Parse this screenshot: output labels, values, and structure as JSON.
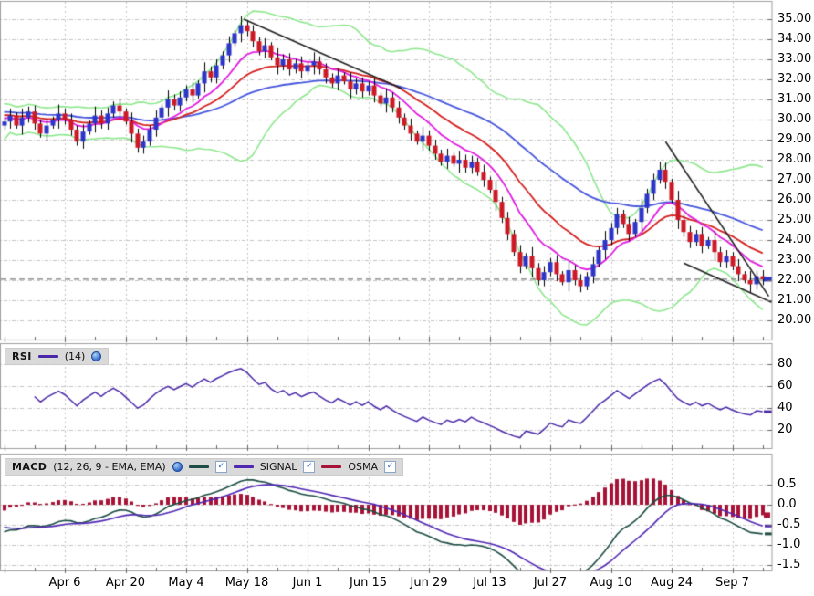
{
  "chart_data": {
    "type": "candlestick",
    "panels": [
      "price",
      "rsi",
      "macd"
    ],
    "price_axis_labels": [
      {
        "v": 35,
        "t": "35.00"
      },
      {
        "v": 34,
        "t": "34.00"
      },
      {
        "v": 33,
        "t": "33.00"
      },
      {
        "v": 32,
        "t": "32.00"
      },
      {
        "v": 31,
        "t": "31.00"
      },
      {
        "v": 30,
        "t": "30.00"
      },
      {
        "v": 29,
        "t": "29.00"
      },
      {
        "v": 28,
        "t": "28.00"
      },
      {
        "v": 27,
        "t": "27.00"
      },
      {
        "v": 26,
        "t": "26.00"
      },
      {
        "v": 25,
        "t": "25.00"
      },
      {
        "v": 24,
        "t": "24.00"
      },
      {
        "v": 23,
        "t": "23.00"
      },
      {
        "v": 22,
        "t": "22.00"
      },
      {
        "v": 21,
        "t": "21.00"
      },
      {
        "v": 20,
        "t": "20.00"
      }
    ],
    "x_ticks": [
      {
        "day": 10,
        "label": "Apr 6"
      },
      {
        "day": 20,
        "label": "Apr 20"
      },
      {
        "day": 30,
        "label": "May 4"
      },
      {
        "day": 40,
        "label": "May 18"
      },
      {
        "day": 50,
        "label": "Jun 1"
      },
      {
        "day": 60,
        "label": "Jun 15"
      },
      {
        "day": 70,
        "label": "Jun 29"
      },
      {
        "day": 80,
        "label": "Jul 13"
      },
      {
        "day": 90,
        "label": "Jul 27"
      },
      {
        "day": 100,
        "label": "Aug 10"
      },
      {
        "day": 110,
        "label": "Aug 24"
      },
      {
        "day": 120,
        "label": "Sep 7"
      }
    ],
    "candles": [
      [
        29.7,
        30.1,
        29.5,
        29.9
      ],
      [
        29.9,
        30.55,
        29.55,
        30.2
      ],
      [
        30.2,
        30.35,
        29.55,
        29.7
      ],
      [
        29.7,
        30.55,
        29.25,
        30.1
      ],
      [
        30.1,
        30.65,
        29.85,
        30.4
      ],
      [
        30.4,
        30.7,
        29.5,
        29.8
      ],
      [
        29.8,
        30.0,
        29.1,
        29.3
      ],
      [
        29.3,
        30.05,
        28.95,
        29.7
      ],
      [
        29.7,
        30.15,
        29.55,
        30.0
      ],
      [
        30.0,
        30.75,
        29.55,
        30.3
      ],
      [
        30.3,
        30.55,
        29.75,
        30.0
      ],
      [
        30.0,
        30.3,
        29.2,
        29.5
      ],
      [
        29.5,
        29.7,
        28.7,
        28.9
      ],
      [
        28.9,
        29.75,
        28.55,
        29.4
      ],
      [
        29.4,
        29.95,
        29.25,
        29.8
      ],
      [
        29.8,
        30.65,
        29.35,
        30.2
      ],
      [
        30.2,
        30.45,
        29.55,
        29.8
      ],
      [
        29.8,
        30.6,
        29.5,
        30.3
      ],
      [
        30.3,
        30.9,
        30.1,
        30.7
      ],
      [
        30.7,
        31.05,
        30.05,
        30.4
      ],
      [
        30.4,
        30.55,
        29.75,
        29.9
      ],
      [
        29.9,
        30.35,
        28.85,
        29.3
      ],
      [
        29.3,
        29.55,
        28.35,
        28.6
      ],
      [
        28.6,
        29.2,
        28.3,
        28.9
      ],
      [
        28.9,
        29.7,
        28.7,
        29.5
      ],
      [
        29.5,
        30.45,
        29.15,
        30.1
      ],
      [
        30.1,
        30.75,
        29.95,
        30.6
      ],
      [
        30.6,
        31.45,
        30.15,
        31.0
      ],
      [
        31.0,
        31.25,
        30.45,
        30.7
      ],
      [
        30.7,
        31.4,
        30.4,
        31.1
      ],
      [
        31.1,
        31.7,
        30.9,
        31.5
      ],
      [
        31.5,
        31.85,
        30.85,
        31.2
      ],
      [
        31.2,
        31.95,
        31.05,
        31.8
      ],
      [
        31.8,
        32.85,
        31.35,
        32.4
      ],
      [
        32.4,
        32.65,
        31.85,
        32.1
      ],
      [
        32.1,
        33.0,
        31.8,
        32.7
      ],
      [
        32.7,
        33.4,
        32.5,
        33.2
      ],
      [
        33.2,
        34.15,
        32.85,
        33.8
      ],
      [
        33.8,
        34.45,
        33.65,
        34.3
      ],
      [
        34.3,
        35.15,
        33.85,
        34.7
      ],
      [
        34.7,
        34.95,
        34.15,
        34.4
      ],
      [
        34.4,
        34.7,
        33.6,
        33.9
      ],
      [
        33.9,
        34.1,
        33.2,
        33.4
      ],
      [
        33.4,
        34.05,
        33.05,
        33.7
      ],
      [
        33.7,
        33.85,
        32.95,
        33.1
      ],
      [
        33.1,
        33.55,
        32.25,
        32.7
      ],
      [
        32.7,
        33.25,
        32.45,
        33.0
      ],
      [
        33.0,
        33.3,
        32.2,
        32.5
      ],
      [
        32.5,
        33.0,
        32.3,
        32.8
      ],
      [
        32.8,
        33.15,
        32.05,
        32.4
      ],
      [
        32.4,
        32.85,
        32.25,
        32.7
      ],
      [
        32.7,
        33.35,
        32.25,
        32.9
      ],
      [
        32.9,
        33.15,
        32.25,
        32.5
      ],
      [
        32.5,
        32.8,
        31.8,
        32.1
      ],
      [
        32.1,
        32.3,
        31.6,
        31.8
      ],
      [
        31.8,
        32.55,
        31.45,
        32.2
      ],
      [
        32.2,
        32.35,
        31.75,
        31.9
      ],
      [
        31.9,
        32.35,
        31.05,
        31.5
      ],
      [
        31.5,
        32.05,
        31.25,
        31.8
      ],
      [
        31.8,
        32.1,
        31.1,
        31.4
      ],
      [
        31.4,
        31.9,
        31.2,
        31.7
      ],
      [
        31.7,
        32.05,
        30.85,
        31.2
      ],
      [
        31.2,
        31.35,
        30.65,
        30.8
      ],
      [
        30.8,
        31.55,
        30.35,
        31.1
      ],
      [
        31.1,
        31.35,
        30.35,
        30.6
      ],
      [
        30.6,
        30.9,
        29.8,
        30.1
      ],
      [
        30.1,
        30.3,
        29.5,
        29.7
      ],
      [
        29.7,
        30.05,
        28.95,
        29.3
      ],
      [
        29.3,
        29.45,
        28.75,
        28.9
      ],
      [
        28.9,
        29.65,
        28.45,
        29.2
      ],
      [
        29.2,
        29.45,
        28.45,
        28.7
      ],
      [
        28.7,
        29.0,
        28.0,
        28.3
      ],
      [
        28.3,
        28.5,
        27.7,
        27.9
      ],
      [
        27.9,
        28.55,
        27.55,
        28.2
      ],
      [
        28.2,
        28.35,
        27.65,
        27.8
      ],
      [
        27.8,
        28.45,
        27.35,
        28.0
      ],
      [
        28.0,
        28.25,
        27.35,
        27.6
      ],
      [
        27.6,
        28.2,
        27.3,
        27.9
      ],
      [
        27.9,
        28.1,
        27.2,
        27.4
      ],
      [
        27.4,
        27.75,
        26.65,
        27.0
      ],
      [
        27.0,
        27.15,
        26.35,
        26.5
      ],
      [
        26.5,
        26.95,
        25.45,
        25.9
      ],
      [
        25.9,
        26.15,
        24.85,
        25.1
      ],
      [
        25.1,
        25.4,
        24.0,
        24.3
      ],
      [
        24.3,
        24.5,
        23.2,
        23.4
      ],
      [
        23.4,
        23.75,
        22.35,
        22.7
      ],
      [
        22.7,
        23.35,
        22.55,
        23.2
      ],
      [
        23.2,
        23.65,
        22.15,
        22.6
      ],
      [
        22.6,
        22.85,
        21.75,
        22.0
      ],
      [
        22.0,
        22.7,
        21.7,
        22.4
      ],
      [
        22.4,
        23.1,
        22.2,
        22.9
      ],
      [
        22.9,
        23.25,
        21.95,
        22.3
      ],
      [
        22.3,
        22.45,
        21.75,
        21.9
      ],
      [
        21.9,
        22.95,
        21.45,
        22.5
      ],
      [
        22.5,
        22.75,
        21.75,
        22.0
      ],
      [
        22.0,
        22.3,
        21.4,
        21.7
      ],
      [
        21.7,
        22.4,
        21.5,
        22.2
      ],
      [
        22.2,
        23.15,
        21.85,
        22.8
      ],
      [
        22.8,
        23.65,
        22.65,
        23.5
      ],
      [
        23.5,
        24.45,
        23.05,
        24.0
      ],
      [
        24.0,
        24.85,
        23.75,
        24.6
      ],
      [
        24.6,
        25.6,
        24.3,
        25.3
      ],
      [
        25.3,
        25.5,
        24.6,
        24.8
      ],
      [
        24.8,
        25.15,
        23.95,
        24.3
      ],
      [
        24.3,
        25.05,
        24.15,
        24.9
      ],
      [
        24.9,
        26.05,
        24.45,
        25.6
      ],
      [
        25.6,
        26.55,
        25.35,
        26.3
      ],
      [
        26.3,
        27.3,
        26.0,
        27.0
      ],
      [
        27.0,
        27.9,
        26.8,
        27.5
      ],
      [
        27.5,
        27.85,
        26.55,
        26.9
      ],
      [
        26.9,
        27.05,
        25.85,
        26.0
      ],
      [
        26.0,
        26.45,
        24.55,
        25.0
      ],
      [
        25.0,
        25.25,
        24.15,
        24.4
      ],
      [
        24.4,
        24.7,
        23.6,
        23.9
      ],
      [
        23.9,
        24.5,
        23.7,
        24.3
      ],
      [
        24.3,
        24.65,
        23.35,
        23.7
      ],
      [
        23.7,
        24.15,
        23.55,
        24.0
      ],
      [
        24.0,
        24.45,
        22.95,
        23.4
      ],
      [
        23.4,
        23.65,
        22.65,
        22.9
      ],
      [
        22.9,
        23.5,
        22.6,
        23.2
      ],
      [
        23.2,
        23.4,
        22.5,
        22.7
      ],
      [
        22.7,
        23.05,
        21.95,
        22.3
      ],
      [
        22.3,
        22.45,
        21.85,
        22.0
      ],
      [
        22.0,
        22.45,
        21.35,
        21.8
      ],
      [
        21.8,
        22.45,
        21.55,
        22.2
      ],
      [
        22.2,
        22.5,
        21.75,
        22.05
      ]
    ],
    "last_price": 22.05,
    "overlays": {
      "bollinger": {
        "period": 20,
        "deviations": 2
      },
      "ema_fast_period": 10,
      "ema_mid_period": 20,
      "ema_slow_period": 45
    },
    "trendlines": [
      {
        "from": [
          39.5,
          35.0
        ],
        "to": [
          65.5,
          31.55
        ]
      },
      {
        "from": [
          109.0,
          28.9
        ],
        "to": [
          126.0,
          21.2
        ]
      },
      {
        "from": [
          112.0,
          22.85
        ],
        "to": [
          126.5,
          20.9
        ]
      }
    ],
    "rsi": {
      "label": "RSI",
      "params": "(14)",
      "period": 14,
      "axis_labels": [
        {
          "v": 80,
          "t": "80"
        },
        {
          "v": 60,
          "t": "60"
        },
        {
          "v": 40,
          "t": "40"
        },
        {
          "v": 20,
          "t": "20"
        }
      ]
    },
    "macd": {
      "label": "MACD",
      "params": "(12, 26, 9 - EMA, EMA)",
      "signal_label": "SIGNAL",
      "osma_label": "OSMA",
      "fast": 12,
      "slow": 26,
      "signal": 9,
      "axis_labels": [
        {
          "v": 0.5,
          "t": "0.5"
        },
        {
          "v": 0.0,
          "t": "0.0"
        },
        {
          "v": -0.5,
          "t": "-0.5"
        },
        {
          "v": -1.0,
          "t": "-1.0"
        },
        {
          "v": -1.5,
          "t": "-1.5"
        }
      ],
      "display_extremes": {
        "macd_max": 0.62,
        "macd_min": -1.9,
        "osma_max": 0.65,
        "osma_min": -0.5
      }
    },
    "colors": {
      "up_candle": "#2d35c8",
      "down_candle": "#cd1926",
      "wick": "#000000",
      "bollinger": "#8fe88f",
      "ema_fast": "#e01ee0",
      "ema_mid": "#d42020",
      "ema_slow": "#4656dd",
      "rsi_line": "#4a28a8",
      "macd_line": "#1d4d44",
      "signal_line": "#5128b4",
      "osma_bar": "#a81236",
      "trendline": "#222222",
      "grid": "#c4c4c4",
      "panel_border": "#a0a0a0",
      "last_price_line": "#7a7a7a",
      "legend_bg": "#d9d9d9",
      "check": "#1f66cc"
    }
  }
}
